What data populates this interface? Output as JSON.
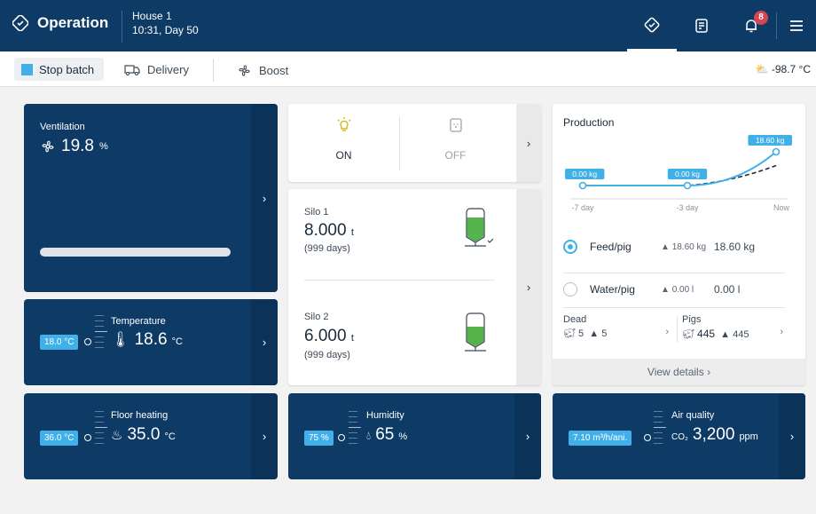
{
  "header": {
    "title": "Operation",
    "house": "House 1",
    "time": "10:31, Day 50",
    "notification_count": "8"
  },
  "actions": {
    "stop_batch": "Stop batch",
    "delivery": "Delivery",
    "boost": "Boost",
    "weather": "-98.7 °C"
  },
  "ventilation": {
    "label": "Ventilation",
    "value": "19.8",
    "unit": "%"
  },
  "temperature": {
    "label": "Temperature",
    "setpoint": "18.0 °C",
    "value": "18.6",
    "unit": "°C"
  },
  "floor_heating": {
    "label": "Floor heating",
    "setpoint": "36.0 °C",
    "value": "35.0",
    "unit": "°C"
  },
  "light": {
    "on_label": "ON",
    "off_label": "OFF"
  },
  "silos": [
    {
      "label": "Silo 1",
      "value": "8.000",
      "unit": "t",
      "days": "(999 days)"
    },
    {
      "label": "Silo 2",
      "value": "6.000",
      "unit": "t",
      "days": "(999 days)"
    }
  ],
  "humidity": {
    "label": "Humidity",
    "setpoint": "75 %",
    "value": "65",
    "unit": "%"
  },
  "air_quality": {
    "label": "Air quality",
    "setpoint": "7.10 m³/h/ani.",
    "prefix": "CO₂",
    "value": "3,200",
    "unit": "ppm"
  },
  "production": {
    "title": "Production",
    "chart_labels": [
      "0.00 kg",
      "0.00 kg",
      "18.60 kg"
    ],
    "x_ticks": [
      "-7 day",
      "-3 day",
      "Now"
    ],
    "feed": {
      "name": "Feed/pig",
      "trend": "18.60",
      "trend_unit": "kg",
      "value": "18.60 kg"
    },
    "water": {
      "name": "Water/pig",
      "trend": "0.00 l",
      "value": "0.00 l"
    },
    "dead": {
      "label": "Dead",
      "count": "5",
      "trend": "5"
    },
    "pigs": {
      "label": "Pigs",
      "count": "445",
      "trend": "445"
    },
    "view_details": "View details"
  },
  "chart_data": {
    "type": "line",
    "x": [
      "-7 day",
      "-3 day",
      "Now"
    ],
    "series": [
      {
        "values": [
          0.0,
          0.0,
          18.6
        ]
      }
    ],
    "title": "",
    "xlabel": "",
    "ylabel": ""
  }
}
